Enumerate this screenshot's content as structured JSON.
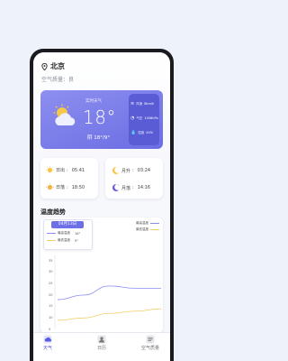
{
  "header": {
    "city": "北京",
    "air_quality": "空气质量：良"
  },
  "weather": {
    "live_label": "实时天气",
    "temperature": "18°",
    "condition": "阴 18°/9°",
    "details": [
      {
        "icon": "wind-icon",
        "label": "风速",
        "value": "8km/h"
      },
      {
        "icon": "pressure-icon",
        "label": "气压",
        "value": "1008hPa"
      },
      {
        "icon": "humidity-icon",
        "label": "湿度",
        "value": "44%"
      }
    ]
  },
  "sun": {
    "sunrise_label": "日出",
    "sunrise": "05:41",
    "sunset_label": "日落",
    "sunset": "18:50"
  },
  "moon": {
    "moonrise_label": "月升",
    "moonrise": "03:24",
    "moonset_label": "月落",
    "moonset": "14:16"
  },
  "trend": {
    "title": "温度趋势",
    "tooltip": {
      "date": "04月13日",
      "high_label": "最高温度",
      "high_value": "18°",
      "low_label": "最低温度",
      "low_value": "9°"
    },
    "legend": {
      "high": "最高温度",
      "low": "最低温度"
    },
    "colors": {
      "high": "#8b8df2",
      "low": "#f3cf69"
    }
  },
  "chart_data": {
    "type": "line",
    "title": "温度趋势",
    "xlabel": "",
    "ylabel": "",
    "y_ticks": [
      "5",
      "10",
      "15",
      "20",
      "25",
      "30",
      "35"
    ],
    "ylim": [
      5,
      35
    ],
    "x": [
      1,
      2,
      3,
      4,
      5
    ],
    "series": [
      {
        "name": "最高温度",
        "values": [
          18,
          20,
          24,
          23,
          23
        ]
      },
      {
        "name": "最低温度",
        "values": [
          9,
          10,
          12,
          13,
          14
        ]
      }
    ]
  },
  "tabs": [
    {
      "label": "天气",
      "icon": "weather-icon",
      "active": true
    },
    {
      "label": "日历",
      "icon": "calendar-icon",
      "active": false
    },
    {
      "label": "空气质量",
      "icon": "air-quality-icon",
      "active": false
    }
  ]
}
